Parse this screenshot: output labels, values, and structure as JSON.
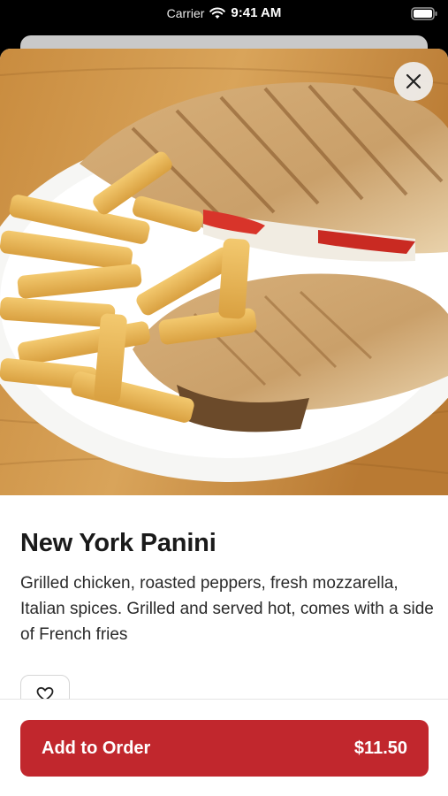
{
  "status_bar": {
    "carrier": "Carrier",
    "time": "9:41 AM",
    "wifi_icon": "wifi-icon",
    "battery_icon": "battery-icon"
  },
  "item": {
    "image_subject": "panini-with-fries-photo",
    "name": "New York Panini",
    "description": "Grilled chicken, roasted peppers, fresh mozzarella, Italian spices. Grilled and served hot, comes with a side of French fries",
    "favorite_icon": "heart-icon"
  },
  "controls": {
    "close_icon": "close-icon"
  },
  "order_button": {
    "label": "Add to Order",
    "price": "$11.50"
  },
  "colors": {
    "accent": "#c1272d",
    "text": "#1a1a1a"
  }
}
